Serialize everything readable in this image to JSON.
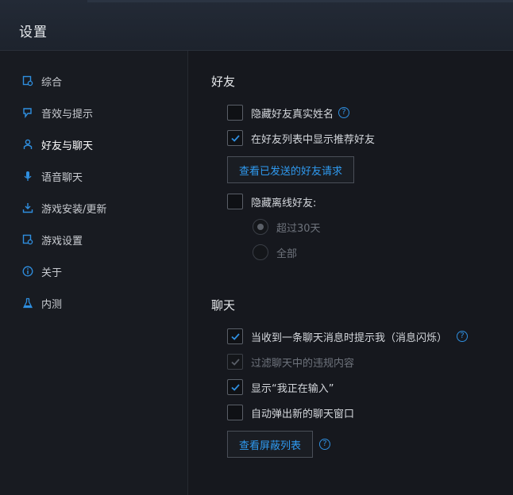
{
  "window": {
    "title": "设置"
  },
  "colors": {
    "accent": "#2f8fe0",
    "background": "#16181e",
    "sidebar": "#181b21"
  },
  "sidebar": {
    "items": [
      {
        "label": "综合",
        "icon": "general-settings-icon"
      },
      {
        "label": "音效与提示",
        "icon": "sound-icon"
      },
      {
        "label": "好友与聊天",
        "icon": "friends-icon",
        "active": true
      },
      {
        "label": "语音聊天",
        "icon": "microphone-icon"
      },
      {
        "label": "游戏安装/更新",
        "icon": "download-icon"
      },
      {
        "label": "游戏设置",
        "icon": "game-settings-icon"
      },
      {
        "label": "关于",
        "icon": "info-icon"
      },
      {
        "label": "内测",
        "icon": "flask-icon"
      }
    ]
  },
  "friends": {
    "title": "好友",
    "hide_real_name": {
      "label": "隐藏好友真实姓名",
      "checked": false
    },
    "show_recommended": {
      "label": "在好友列表中显示推荐好友",
      "checked": true
    },
    "sent_requests_button": "查看已发送的好友请求",
    "hide_offline": {
      "label": "隐藏离线好友:",
      "checked": false
    },
    "offline_options": [
      {
        "label": "超过30天",
        "selected": true
      },
      {
        "label": "全部",
        "selected": false
      }
    ]
  },
  "chat": {
    "title": "聊天",
    "notify_message": {
      "label": "当收到一条聊天消息时提示我（消息闪烁）",
      "checked": true
    },
    "filter_content": {
      "label": "过滤聊天中的违规内容",
      "checked": true,
      "disabled": true
    },
    "show_typing": {
      "label": "显示“我正在输入”",
      "checked": true
    },
    "auto_popup": {
      "label": "自动弹出新的聊天窗口",
      "checked": false
    },
    "block_list_button": "查看屏蔽列表"
  },
  "help_icon_glyph": "?"
}
